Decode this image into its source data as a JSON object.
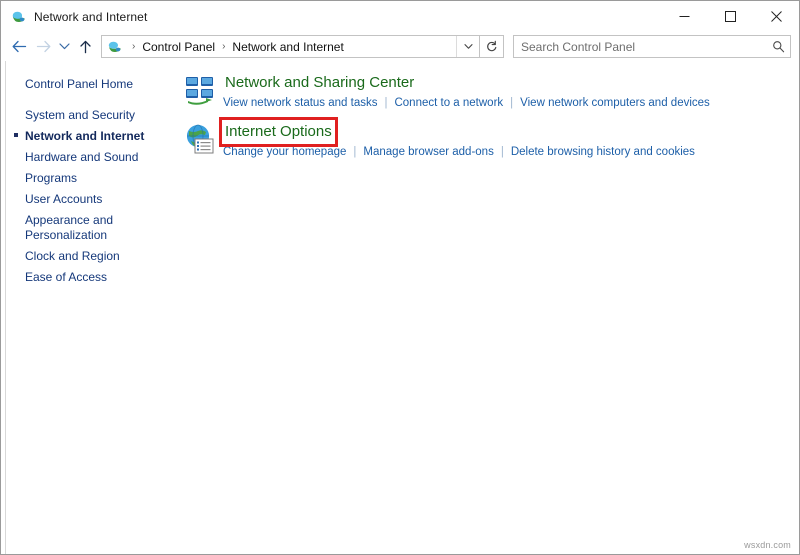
{
  "window": {
    "title": "Network and Internet",
    "title_icon": "control-panel-icon",
    "caption": {
      "minimize": "minimize-icon",
      "maximize": "maximize-icon",
      "close": "close-icon"
    }
  },
  "addressbar": {
    "back": "back-arrow-icon",
    "forward": "forward-arrow-icon",
    "recent": "recent-locations-chevron-icon",
    "up": "up-arrow-icon",
    "breadcrumb_icon": "control-panel-icon",
    "breadcrumbs": [
      "Control Panel",
      "Network and Internet"
    ],
    "separator": "›",
    "dropdown": "address-dropdown-chevron-icon",
    "refresh": "refresh-icon"
  },
  "search": {
    "placeholder": "Search Control Panel",
    "value": "",
    "icon": "search-icon"
  },
  "sidebar": {
    "items": [
      {
        "label": "Control Panel Home",
        "current": false
      },
      {
        "label": "System and Security",
        "current": false
      },
      {
        "label": "Network and Internet",
        "current": true
      },
      {
        "label": "Hardware and Sound",
        "current": false
      },
      {
        "label": "Programs",
        "current": false
      },
      {
        "label": "User Accounts",
        "current": false
      },
      {
        "label": "Appearance and\nPersonalization",
        "current": false
      },
      {
        "label": "Clock and Region",
        "current": false
      },
      {
        "label": "Ease of Access",
        "current": false
      }
    ]
  },
  "content": {
    "categories": [
      {
        "title": "Network and Sharing Center",
        "icon": "network-sharing-center-icon",
        "highlighted": false,
        "links": [
          "View network status and tasks",
          "Connect to a network",
          "View network computers and devices"
        ]
      },
      {
        "title": "Internet Options",
        "icon": "internet-options-icon",
        "highlighted": true,
        "links": [
          "Change your homepage",
          "Manage browser add-ons",
          "Delete browsing history and cookies"
        ]
      }
    ]
  },
  "watermark": "wsxdn.com",
  "colors": {
    "heading_green": "#1a6a1b",
    "link_blue": "#1d5fa8",
    "sidebar_blue": "#15387a",
    "highlight_red": "#e02020"
  }
}
